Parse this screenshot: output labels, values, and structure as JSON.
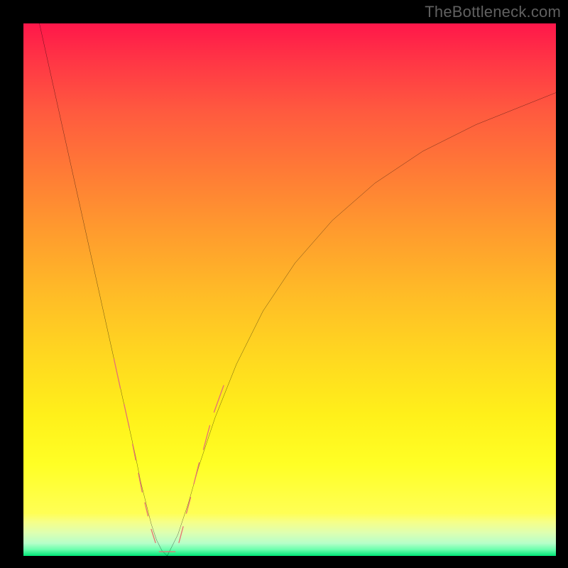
{
  "watermark": {
    "text": "TheBottleneck.com"
  },
  "chart_data": {
    "type": "line",
    "title": "",
    "xlabel": "",
    "ylabel": "",
    "xlim": [
      0,
      100
    ],
    "ylim": [
      0,
      100
    ],
    "grid": false,
    "legend": null,
    "background_gradient": {
      "direction": "vertical",
      "stops": [
        {
          "pos": 0.0,
          "color": "#ff174a"
        },
        {
          "pos": 0.5,
          "color": "#ffbb27"
        },
        {
          "pos": 0.9,
          "color": "#ffff55"
        },
        {
          "pos": 1.0,
          "color": "#00e676"
        }
      ]
    },
    "series": [
      {
        "name": "left_curve",
        "x": [
          3,
          5,
          7,
          9,
          11,
          13,
          15,
          17,
          19,
          21,
          22,
          23,
          24,
          25,
          26,
          27
        ],
        "y": [
          100,
          91,
          82,
          73,
          64,
          55,
          46,
          37,
          28,
          19,
          14,
          10,
          6,
          3,
          1,
          0
        ],
        "stroke": "#000000",
        "stroke_width": 2.2
      },
      {
        "name": "right_curve",
        "x": [
          27,
          29,
          31,
          33,
          36,
          40,
          45,
          51,
          58,
          66,
          75,
          85,
          95,
          100
        ],
        "y": [
          0,
          4,
          10,
          17,
          26,
          36,
          46,
          55,
          63,
          70,
          76,
          81,
          85,
          87
        ],
        "stroke": "#000000",
        "stroke_width": 2.2
      }
    ],
    "markers": [
      {
        "name": "left_segment_1",
        "x1": 17.0,
        "y1": 37.0,
        "x2": 18.2,
        "y2": 31.5,
        "color": "#e57373",
        "width": 10
      },
      {
        "name": "left_segment_2",
        "x1": 18.9,
        "y1": 28.5,
        "x2": 19.9,
        "y2": 24.0,
        "color": "#e57373",
        "width": 10
      },
      {
        "name": "left_segment_3",
        "x1": 20.5,
        "y1": 21.0,
        "x2": 21.1,
        "y2": 18.0,
        "color": "#e57373",
        "width": 10
      },
      {
        "name": "left_segment_4",
        "x1": 21.6,
        "y1": 15.5,
        "x2": 22.3,
        "y2": 12.0,
        "color": "#e57373",
        "width": 10
      },
      {
        "name": "left_segment_5",
        "x1": 22.8,
        "y1": 10.0,
        "x2": 23.4,
        "y2": 7.5,
        "color": "#e57373",
        "width": 10
      },
      {
        "name": "left_segment_6",
        "x1": 24.0,
        "y1": 5.0,
        "x2": 24.8,
        "y2": 2.5,
        "color": "#e57373",
        "width": 10
      },
      {
        "name": "bottom_segment",
        "x1": 25.5,
        "y1": 0.8,
        "x2": 28.5,
        "y2": 0.8,
        "color": "#e57373",
        "width": 10
      },
      {
        "name": "right_segment_1",
        "x1": 29.2,
        "y1": 2.5,
        "x2": 30.0,
        "y2": 5.5,
        "color": "#e57373",
        "width": 10
      },
      {
        "name": "right_segment_2",
        "x1": 30.6,
        "y1": 8.0,
        "x2": 31.4,
        "y2": 11.0,
        "color": "#e57373",
        "width": 10
      },
      {
        "name": "right_segment_3",
        "x1": 32.0,
        "y1": 13.5,
        "x2": 33.0,
        "y2": 17.5,
        "color": "#e57373",
        "width": 10
      },
      {
        "name": "right_segment_4",
        "x1": 33.8,
        "y1": 20.0,
        "x2": 35.0,
        "y2": 24.5,
        "color": "#e57373",
        "width": 10
      },
      {
        "name": "right_segment_5",
        "x1": 35.8,
        "y1": 27.0,
        "x2": 37.6,
        "y2": 32.0,
        "color": "#e57373",
        "width": 10
      }
    ]
  }
}
